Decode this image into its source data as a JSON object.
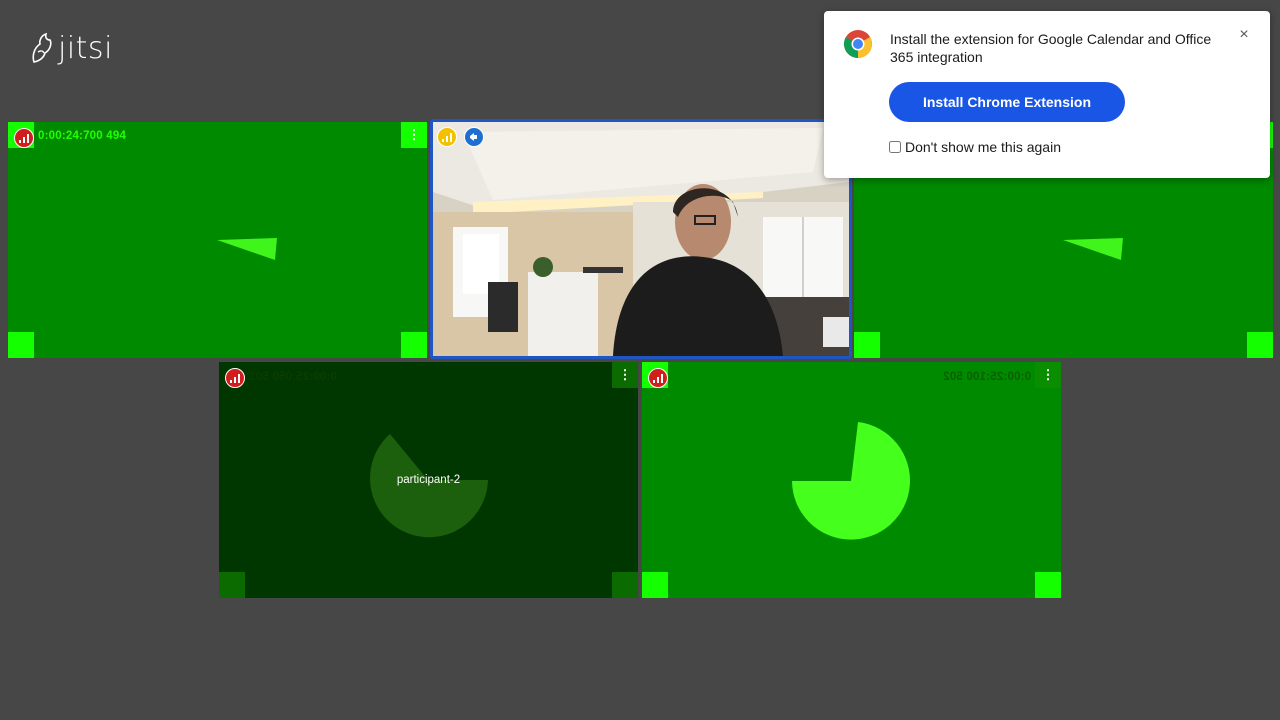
{
  "app": {
    "logo_text": "jitsi"
  },
  "tiles": {
    "tile1": {
      "timer": "0:00:24:700 494"
    },
    "tile4": {
      "timer": "0:00:25:050 501",
      "participant_name": "participant-2"
    },
    "tile5": {
      "timer": "0:00:25:100 502"
    }
  },
  "popup": {
    "message": "Install the extension for Google Calendar and Office 365 integration",
    "install_button_label": "Install Chrome Extension",
    "dont_show_label": "Don't show me this again",
    "close_glyph": "×"
  },
  "icons": {
    "logo": "jitsi-bird-logo-icon",
    "connection": "connection-bars-icon",
    "more": "more-vertical-icon",
    "speaker": "megaphone-icon",
    "chrome": "chrome-logo-icon"
  },
  "colors": {
    "background": "#474747",
    "tile_green": "#008a00",
    "tile_dark": "#003600",
    "accent_blue": "#1a56e6",
    "indicator_red": "#d21d1d",
    "indicator_yellow": "#f3c100"
  }
}
